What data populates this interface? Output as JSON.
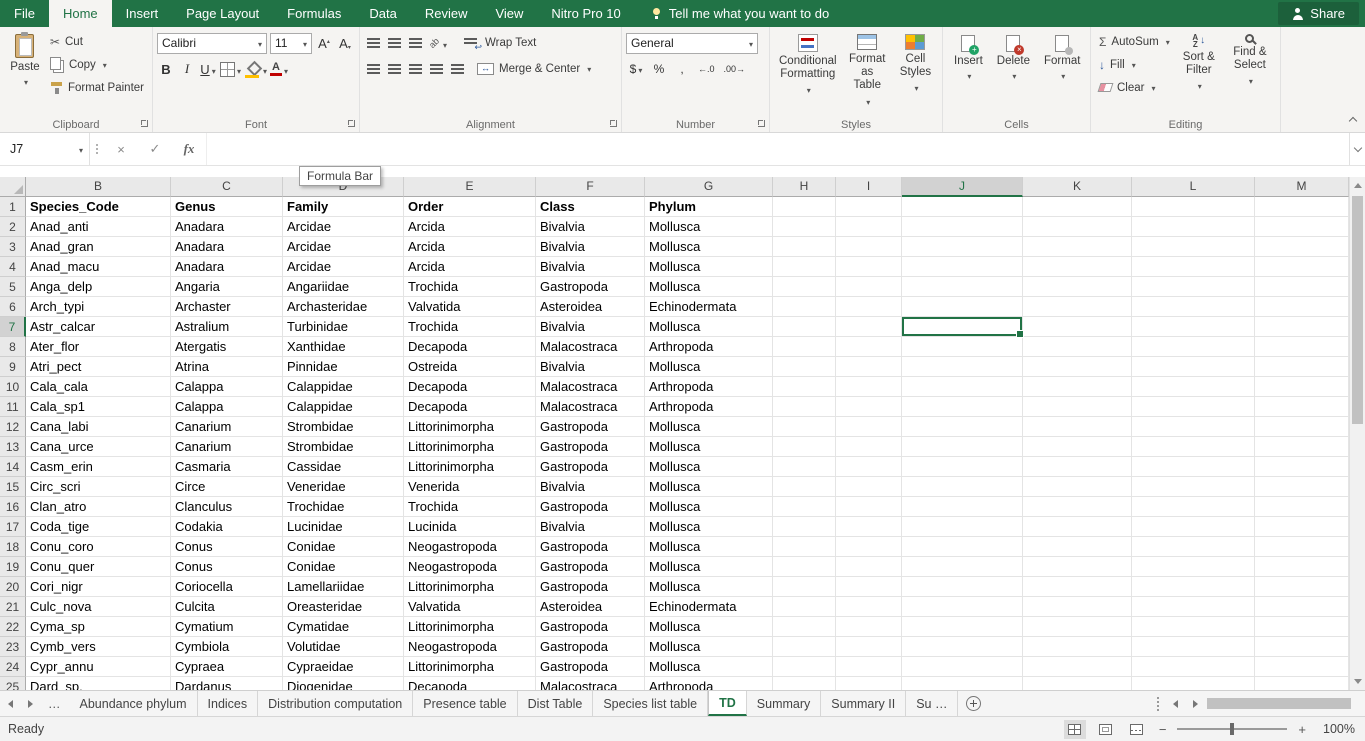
{
  "colors": {
    "accent": "#217346"
  },
  "ribbon": {
    "tabs": [
      {
        "label": "File"
      },
      {
        "label": "Home",
        "active": true
      },
      {
        "label": "Insert"
      },
      {
        "label": "Page Layout"
      },
      {
        "label": "Formulas"
      },
      {
        "label": "Data"
      },
      {
        "label": "Review"
      },
      {
        "label": "View"
      },
      {
        "label": "Nitro Pro 10"
      }
    ],
    "tell_me": "Tell me what you want to do",
    "share": "Share",
    "groups": {
      "clipboard": {
        "label": "Clipboard",
        "paste": "Paste",
        "cut": "Cut",
        "copy": "Copy",
        "format_painter": "Format Painter"
      },
      "font": {
        "label": "Font",
        "font_name": "Calibri",
        "font_size": "11"
      },
      "alignment": {
        "label": "Alignment",
        "wrap_text": "Wrap Text",
        "merge_center": "Merge & Center"
      },
      "number": {
        "label": "Number",
        "format": "General"
      },
      "styles": {
        "label": "Styles",
        "conditional": "Conditional Formatting",
        "format_table": "Format as Table",
        "cell_styles": "Cell Styles"
      },
      "cells": {
        "label": "Cells",
        "insert": "Insert",
        "delete": "Delete",
        "format": "Format"
      },
      "editing": {
        "label": "Editing",
        "autosum": "AutoSum",
        "fill": "Fill",
        "clear": "Clear",
        "sort_filter": "Sort & Filter",
        "find_select": "Find & Select"
      }
    }
  },
  "icons": {
    "scissors": "✂",
    "bold": "B",
    "italic": "I",
    "underline": "U",
    "grow_font": "A",
    "shrink_font": "A",
    "font_color_letter": "A",
    "orientation": "ab",
    "dollar": "$",
    "percent": "%",
    "comma": ",",
    "increase_decimal": "←.0",
    "decrease_decimal": ".00→",
    "autosum_sigma": "Σ",
    "fill_arrow": "↓",
    "sort_a": "A",
    "sort_z": "Z",
    "cancel": "×",
    "enter": "✓",
    "fx": "fx",
    "zoom_out": "−",
    "zoom_in": "+"
  },
  "formula_bar": {
    "name_box": "J7",
    "value": "",
    "tooltip": "Formula Bar"
  },
  "grid": {
    "columns": [
      "B",
      "C",
      "D",
      "E",
      "F",
      "G",
      "H",
      "I",
      "J",
      "K",
      "L",
      "M"
    ],
    "selected": {
      "column": "J",
      "row": 7
    },
    "rows": [
      {
        "n": 1,
        "bold": true,
        "cells": [
          "Species_Code",
          "Genus",
          "Family",
          "Order",
          "Class",
          "Phylum"
        ]
      },
      {
        "n": 2,
        "cells": [
          "Anad_anti",
          "Anadara",
          "Arcidae",
          "Arcida",
          "Bivalvia",
          "Mollusca"
        ]
      },
      {
        "n": 3,
        "cells": [
          "Anad_gran",
          "Anadara",
          "Arcidae",
          "Arcida",
          "Bivalvia",
          "Mollusca"
        ]
      },
      {
        "n": 4,
        "cells": [
          "Anad_macu",
          "Anadara",
          "Arcidae",
          "Arcida",
          "Bivalvia",
          "Mollusca"
        ]
      },
      {
        "n": 5,
        "cells": [
          "Anga_delp",
          "Angaria",
          "Angariidae",
          "Trochida",
          "Gastropoda",
          "Mollusca"
        ]
      },
      {
        "n": 6,
        "cells": [
          "Arch_typi",
          "Archaster",
          "Archasteridae",
          "Valvatida",
          "Asteroidea",
          "Echinodermata"
        ]
      },
      {
        "n": 7,
        "cells": [
          "Astr_calcar",
          "Astralium",
          "Turbinidae",
          "Trochida",
          "Bivalvia",
          "Mollusca"
        ]
      },
      {
        "n": 8,
        "cells": [
          "Ater_flor",
          "Atergatis",
          "Xanthidae",
          "Decapoda",
          "Malacostraca",
          "Arthropoda"
        ]
      },
      {
        "n": 9,
        "cells": [
          "Atri_pect",
          "Atrina",
          "Pinnidae",
          "Ostreida",
          "Bivalvia",
          "Mollusca"
        ]
      },
      {
        "n": 10,
        "cells": [
          "Cala_cala",
          "Calappa",
          "Calappidae",
          "Decapoda",
          "Malacostraca",
          "Arthropoda"
        ]
      },
      {
        "n": 11,
        "cells": [
          "Cala_sp1",
          "Calappa",
          "Calappidae",
          "Decapoda",
          "Malacostraca",
          "Arthropoda"
        ]
      },
      {
        "n": 12,
        "cells": [
          "Cana_labi",
          "Canarium",
          "Strombidae",
          "Littorinimorpha",
          "Gastropoda",
          "Mollusca"
        ]
      },
      {
        "n": 13,
        "cells": [
          "Cana_urce",
          "Canarium",
          "Strombidae",
          "Littorinimorpha",
          "Gastropoda",
          "Mollusca"
        ]
      },
      {
        "n": 14,
        "cells": [
          "Casm_erin",
          "Casmaria",
          "Cassidae",
          "Littorinimorpha",
          "Gastropoda",
          "Mollusca"
        ]
      },
      {
        "n": 15,
        "cells": [
          "Circ_scri",
          "Circe",
          "Veneridae",
          "Venerida",
          "Bivalvia",
          "Mollusca"
        ]
      },
      {
        "n": 16,
        "cells": [
          "Clan_atro",
          "Clanculus",
          "Trochidae",
          "Trochida",
          "Gastropoda",
          "Mollusca"
        ]
      },
      {
        "n": 17,
        "cells": [
          "Coda_tige",
          "Codakia",
          "Lucinidae",
          "Lucinida",
          "Bivalvia",
          "Mollusca"
        ]
      },
      {
        "n": 18,
        "cells": [
          "Conu_coro",
          "Conus",
          "Conidae",
          "Neogastropoda",
          "Gastropoda",
          "Mollusca"
        ]
      },
      {
        "n": 19,
        "cells": [
          "Conu_quer",
          "Conus",
          "Conidae",
          "Neogastropoda",
          "Gastropoda",
          "Mollusca"
        ]
      },
      {
        "n": 20,
        "cells": [
          "Cori_nigr",
          "Coriocella",
          "Lamellariidae",
          "Littorinimorpha",
          "Gastropoda",
          "Mollusca"
        ]
      },
      {
        "n": 21,
        "cells": [
          "Culc_nova",
          "Culcita",
          "Oreasteridae",
          "Valvatida",
          "Asteroidea",
          "Echinodermata"
        ]
      },
      {
        "n": 22,
        "cells": [
          "Cyma_sp",
          "Cymatium",
          "Cymatidae",
          "Littorinimorpha",
          "Gastropoda",
          "Mollusca"
        ]
      },
      {
        "n": 23,
        "cells": [
          "Cymb_vers",
          "Cymbiola",
          "Volutidae",
          "Neogastropoda",
          "Gastropoda",
          "Mollusca"
        ]
      },
      {
        "n": 24,
        "cells": [
          "Cypr_annu",
          "Cypraea",
          "Cypraeidae",
          "Littorinimorpha",
          "Gastropoda",
          "Mollusca"
        ]
      },
      {
        "n": 25,
        "cells": [
          "Dard_sp.",
          "Dardanus",
          "Diogenidae",
          "Decapoda",
          "Malacostraca",
          "Arthropoda"
        ]
      }
    ]
  },
  "sheet_bar": {
    "overflow": "…",
    "tabs": [
      {
        "label": "Abundance phylum"
      },
      {
        "label": "Indices"
      },
      {
        "label": "Distribution computation"
      },
      {
        "label": "Presence table"
      },
      {
        "label": "Dist Table"
      },
      {
        "label": "Species list table"
      },
      {
        "label": "TD",
        "active": true
      },
      {
        "label": "Summary"
      },
      {
        "label": "Summary II"
      },
      {
        "label": "Su …"
      }
    ]
  },
  "status_bar": {
    "mode": "Ready",
    "zoom": "100%"
  }
}
